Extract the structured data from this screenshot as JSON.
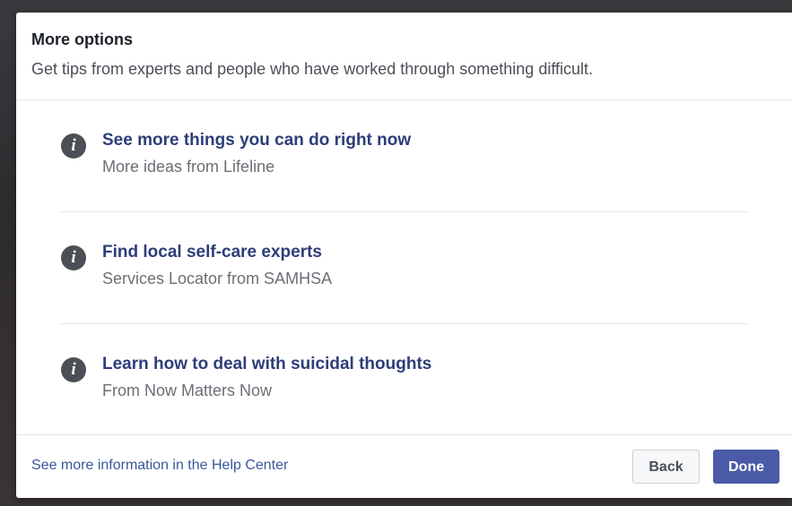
{
  "dialog": {
    "title": "More options",
    "subtitle": "Get tips from experts and people who have worked through something difficult."
  },
  "options": [
    {
      "icon": "info-icon",
      "title": "See more things you can do right now",
      "subtitle": "More ideas from Lifeline"
    },
    {
      "icon": "info-icon",
      "title": "Find local self-care experts",
      "subtitle": "Services Locator from SAMHSA"
    },
    {
      "icon": "info-icon",
      "title": "Learn how to deal with suicidal thoughts",
      "subtitle": "From Now Matters Now"
    }
  ],
  "footer": {
    "help_link": "See more information in the Help Center",
    "back_label": "Back",
    "done_label": "Done"
  },
  "colors": {
    "link": "#365899",
    "option_title": "#2d3e78",
    "primary_button": "#4a5aa6",
    "icon": "#4b4f56"
  }
}
